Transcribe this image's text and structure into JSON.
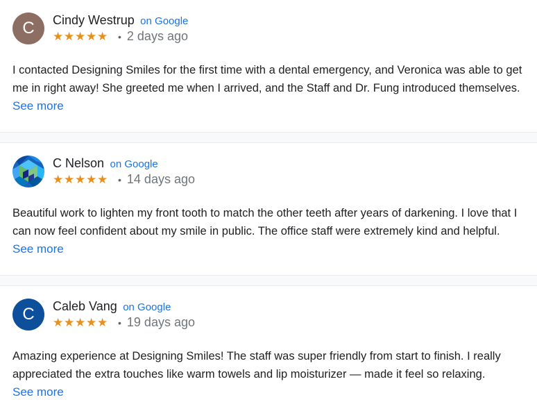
{
  "reviews": [
    {
      "avatar_letter": "C",
      "avatar_color": "#8d6e63",
      "name": "Cindy Westrup",
      "source": "on Google",
      "stars": "★★★★★",
      "dot": "•",
      "time": "2 days ago",
      "text": "I contacted Designing Smiles for the first time with a dental emergency, and Veronica was able to get me in right away! She greeted me when I arrived, and the Staff and Dr. Fung introduced themselves.",
      "see_more": "See more"
    },
    {
      "avatar_letter": "",
      "avatar_icon": "geometric-cube-icon",
      "name": "C Nelson",
      "source": "on Google",
      "stars": "★★★★★",
      "dot": "•",
      "time": "14 days ago",
      "text": "Beautiful work to lighten my front tooth to match the other teeth after years of darkening. I love that I can now feel confident about my smile in public. The office staff were extremely kind and helpful.",
      "see_more": "See more"
    },
    {
      "avatar_letter": "C",
      "avatar_color": "#0d4f9a",
      "name": "Caleb Vang",
      "source": "on Google",
      "stars": "★★★★★",
      "dot": "•",
      "time": "19 days ago",
      "text": "Amazing experience at Designing Smiles! The staff was super friendly from start to finish. I really appreciated the extra touches like warm towels and lip moisturizer — made it feel so relaxing.",
      "see_more": "See more"
    }
  ],
  "colors": {
    "link": "#1a73e8",
    "star": "#e8901b",
    "separator": "#f8f9fa"
  }
}
